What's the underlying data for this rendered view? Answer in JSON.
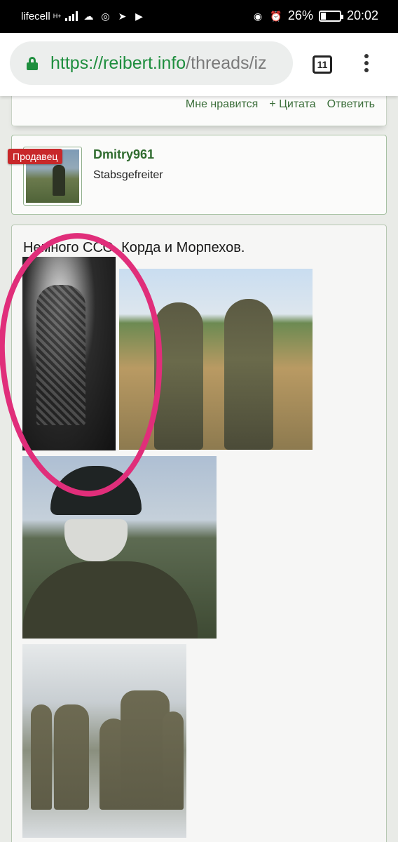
{
  "status_bar": {
    "carrier": "lifecell",
    "network": "H+",
    "battery": "26%",
    "time": "20:02"
  },
  "browser": {
    "url_scheme": "https://",
    "url_host": "reibert.info",
    "url_path": "/threads/iz",
    "tab_count": "11"
  },
  "prev_post_actions": {
    "like": "Мне нравится",
    "quote": "+ Цитата",
    "reply": "Ответить"
  },
  "author": {
    "badge": "Продавец",
    "username": "Dmitry961",
    "rank": "Stabsgefreiter"
  },
  "post": {
    "text": "Немного ССО. Корда и Морпехов."
  },
  "colors": {
    "accent_green": "#2f6b2e",
    "badge_red": "#c8282a",
    "annotation_pink": "#e02e7a"
  }
}
